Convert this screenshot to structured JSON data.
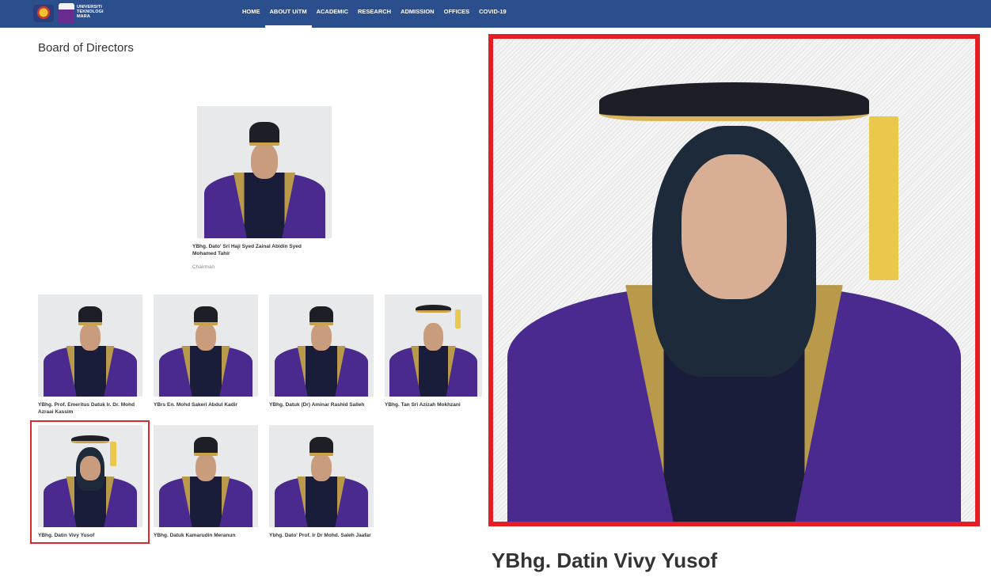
{
  "header": {
    "logo_text": [
      "UNIVERSITI",
      "TEKNOLOGI",
      "MARA"
    ],
    "nav": [
      {
        "label": "HOME",
        "active": false
      },
      {
        "label": "ABOUT UiTM",
        "active": true
      },
      {
        "label": "ACADEMIC",
        "active": false
      },
      {
        "label": "RESEARCH",
        "active": false
      },
      {
        "label": "ADMISSION",
        "active": false
      },
      {
        "label": "OFFICES",
        "active": false
      },
      {
        "label": "COVID-19",
        "active": false
      }
    ]
  },
  "page": {
    "title": "Board of Directors"
  },
  "chairman": {
    "name": "YBhg. Dato' Sri Haji Syed Zainal Abidin Syed Mohamed Tahir",
    "role": "Chairman"
  },
  "directors": [
    {
      "name": "YBhg. Prof. Emeritus Datuk Ir. Dr. Mohd Azraai Kassim"
    },
    {
      "name": "YBrs En. Mohd Sakeri Abdul Kadir"
    },
    {
      "name": "YBhg. Datuk (Dr) Aminar Rashid Salleh"
    },
    {
      "name": "YBhg. Tan Sri Azizah Mokhzani"
    },
    {
      "name": "YBhg. Datin Vivy Yusof"
    },
    {
      "name": "YBhg. Datuk Kamarudin Meranun"
    },
    {
      "name": "Ybhg. Dato' Prof. Ir Dr Mohd. Saleh Jaafar"
    }
  ],
  "highlight": {
    "name": "YBhg. Datin Vivy Yusof",
    "color": "#e31e25"
  },
  "colors": {
    "nav_bg": "#2b4e8c",
    "robe": "#4a2a8f",
    "gold": "#c9a24a"
  }
}
